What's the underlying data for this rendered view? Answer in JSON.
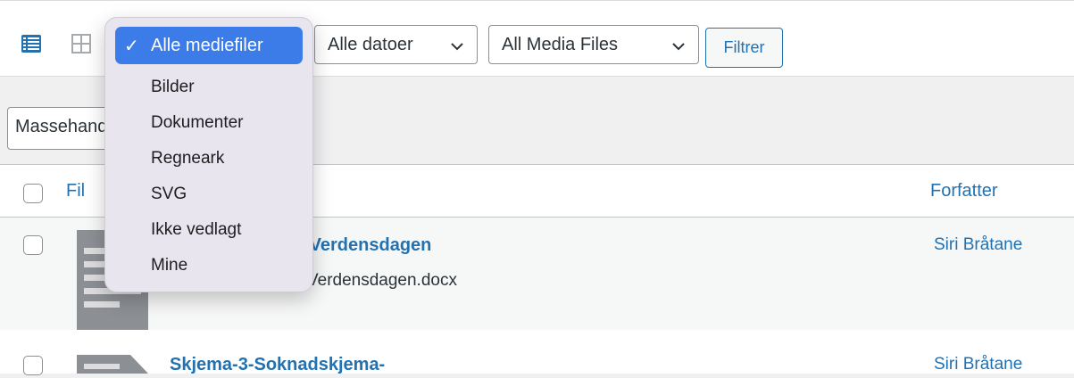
{
  "toolbar": {
    "media_type_selected": "Alle mediefiler",
    "date_filter": "Alle datoer",
    "media_files_filter": "All Media Files",
    "filter_button": "Filtrer"
  },
  "bulk_actions": {
    "label": "Massehandlinger"
  },
  "table": {
    "col_file": "Fil",
    "col_author": "Forfatter",
    "rows": [
      {
        "title": "-Verdensdagen",
        "filename": "Verdensdagen.docx",
        "author": "Siri Bråtane"
      },
      {
        "title": "Skjema-3-Soknadskjema-",
        "author": "Siri Bråtane"
      }
    ]
  },
  "dropdown": {
    "selected": "Alle mediefiler",
    "options": [
      "Bilder",
      "Dokumenter",
      "Regneark",
      "SVG",
      "Ikke vedlagt",
      "Mine"
    ]
  },
  "colors": {
    "link": "#2271b1",
    "menu_highlight": "#3b7ce8"
  }
}
